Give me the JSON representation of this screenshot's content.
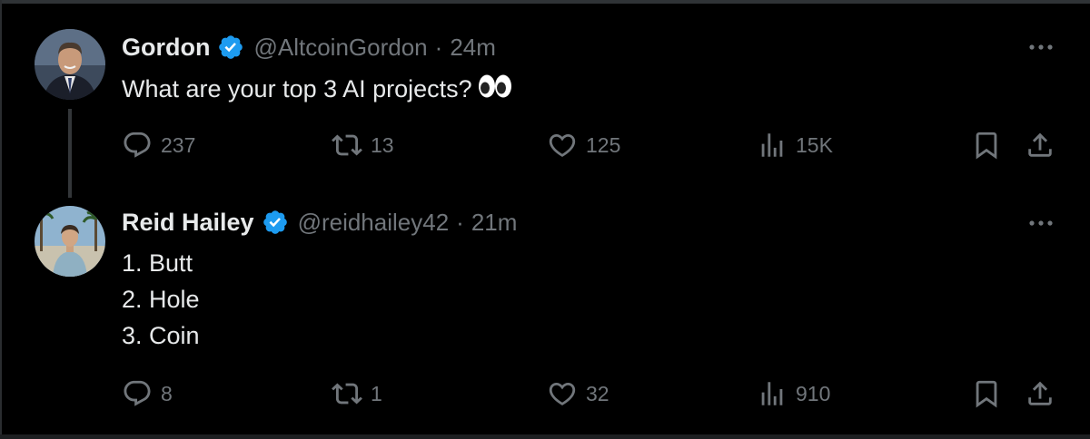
{
  "colors": {
    "background": "#000000",
    "text_primary": "#e7e9ea",
    "text_secondary": "#71767b",
    "verified_blue": "#1d9bf0",
    "thread_line": "#333639"
  },
  "tweets": [
    {
      "display_name": "Gordon",
      "handle": "@AltcoinGordon",
      "separator": "·",
      "time": "24m",
      "text": "What are your top 3 AI projects?",
      "emoji": "eyes-emoji",
      "avatar_icon": "avatar-photo-man-suit",
      "verified_icon": "verified-badge-icon",
      "stats": {
        "replies": "237",
        "reposts": "13",
        "likes": "125",
        "views": "15K"
      }
    },
    {
      "display_name": "Reid Hailey",
      "handle": "@reidhailey42",
      "separator": "·",
      "time": "21m",
      "lines": [
        "1. Butt",
        "2. Hole",
        "3. Coin"
      ],
      "avatar_icon": "avatar-photo-outdoor-palms",
      "verified_icon": "verified-badge-icon",
      "stats": {
        "replies": "8",
        "reposts": "1",
        "likes": "32",
        "views": "910"
      }
    }
  ],
  "icons": {
    "more": "more-options-icon",
    "reply": "reply-icon",
    "repost": "repost-icon",
    "like": "like-heart-icon",
    "views": "views-chart-icon",
    "bookmark": "bookmark-icon",
    "share": "share-icon"
  }
}
